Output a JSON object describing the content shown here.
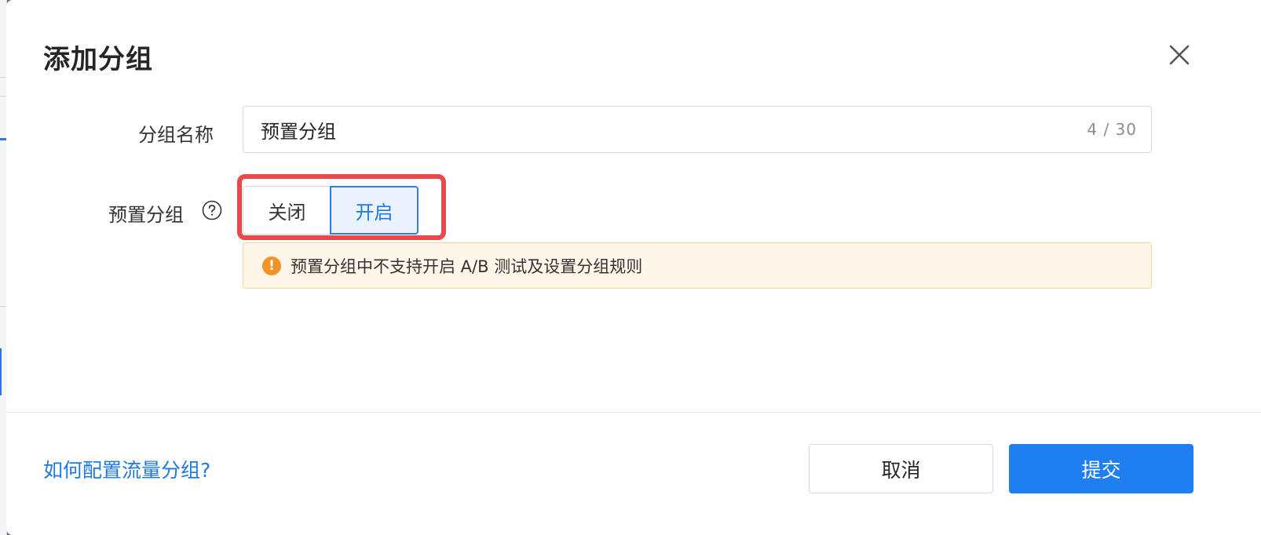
{
  "dialog": {
    "title": "添加分组",
    "close_icon": "close-icon"
  },
  "form": {
    "name_label": "分组名称",
    "name_value": "预置分组",
    "name_count": "4 / 30",
    "preset_label": "预置分组",
    "preset_help_icon": "question-circle-icon",
    "preset_options": [
      "关闭",
      "开启"
    ],
    "preset_selected": "开启",
    "warning_icon": "exclamation-circle-icon",
    "warning_text": "预置分组中不支持开启 A/B 测试及设置分组规则"
  },
  "footer": {
    "help_link": "如何配置流量分组?",
    "cancel_label": "取消",
    "submit_label": "提交"
  },
  "colors": {
    "primary": "#1f7ff0",
    "highlight": "#ea4949",
    "warning": "#f19427"
  }
}
